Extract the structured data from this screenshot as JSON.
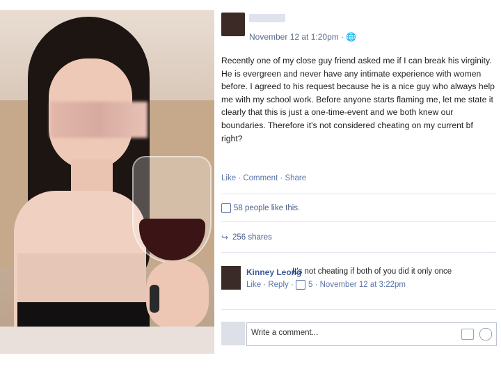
{
  "post": {
    "timestamp": "November 12 at 1:20pm · ",
    "globe_icon": "globe-icon",
    "text": "Recently one of my close guy friend asked me if I can break his virginity. He is evergreen and never have any intimate experience with women before. I agreed to his request because he is a nice guy who always help me with my school work. Before anyone starts flaming me, let me state it clearly that this is just a one-time-event and we both knew our boundaries. Therefore it's not considered cheating on my current bf right?",
    "actions": {
      "like": "Like",
      "comment": "Comment",
      "share": "Share",
      "sep": " · "
    },
    "likes_text": "58 people like this.",
    "shares_text": "256 shares"
  },
  "comment": {
    "author": "Kinney Leong",
    "text": "It's not cheating if both of you did it only once",
    "actions": {
      "like": "Like",
      "reply": "Reply",
      "likes_count": "5",
      "time": "November 12 at 3:22pm",
      "sep": " · "
    }
  },
  "composer": {
    "placeholder": "Write a comment...",
    "camera_icon": "camera-icon",
    "smiley_icon": "smiley-icon"
  }
}
